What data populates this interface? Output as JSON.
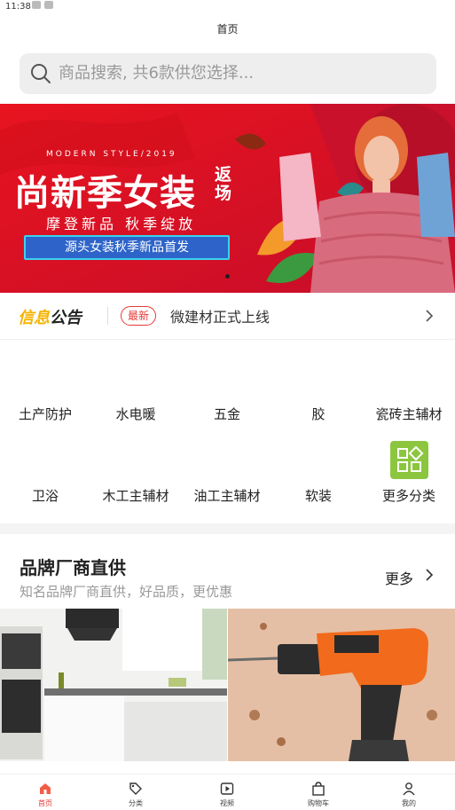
{
  "status": {
    "time": "11:38"
  },
  "header": {
    "title": "首页"
  },
  "search": {
    "placeholder": "商品搜索, 共6款供您选择..."
  },
  "banner": {
    "small_caption": "MODERN STYLE/2019",
    "title": "尚新季女装",
    "title_side": "返场",
    "subtitle": "摩登新品 秋季绽放",
    "pill": "源头女装秋季新品首发"
  },
  "notice": {
    "brand_a": "信息",
    "brand_b": "公告",
    "badge": "最新",
    "text": "微建材正式上线"
  },
  "categories": {
    "row1": [
      "土产防护",
      "水电暖",
      "五金",
      "胶",
      "瓷砖主辅材"
    ],
    "row2": [
      "卫浴",
      "木工主辅材",
      "油工主辅材",
      "软装",
      "更多分类"
    ]
  },
  "brand_section": {
    "title": "品牌厂商直供",
    "subtitle": "知名品牌厂商直供，好品质，更优惠",
    "more": "更多"
  },
  "tabbar": {
    "items": [
      {
        "label": "首页",
        "active": true
      },
      {
        "label": "分类"
      },
      {
        "label": "视频"
      },
      {
        "label": "购物车"
      },
      {
        "label": "我的"
      }
    ]
  },
  "colors": {
    "accent": "#e53935",
    "brand_gold": "#f5b400",
    "more_icon_bg": "#8cc63f"
  }
}
